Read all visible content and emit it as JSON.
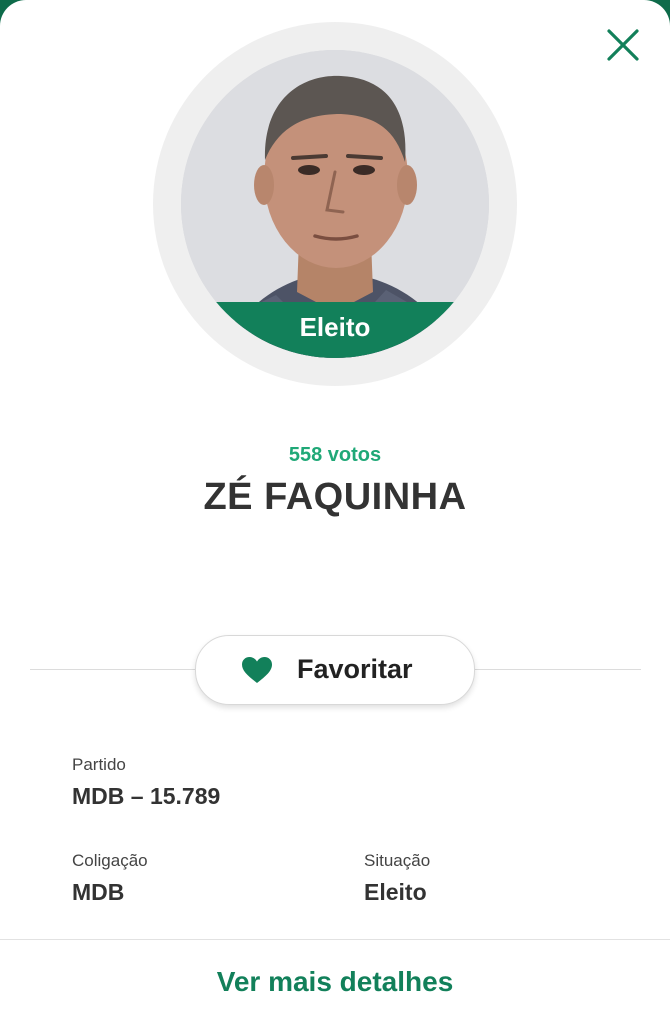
{
  "header": {
    "close_icon": "close-icon"
  },
  "candidate": {
    "status_badge": "Eleito",
    "votes": "558 votos",
    "name": "ZÉ FAQUINHA"
  },
  "favorite": {
    "icon": "heart-icon",
    "label": "Favoritar"
  },
  "info": {
    "partido_label": "Partido",
    "partido_value": "MDB – 15.789",
    "coligacao_label": "Coligação",
    "coligacao_value": "MDB",
    "situacao_label": "Situação",
    "situacao_value": "Eleito"
  },
  "footer": {
    "details_link": "Ver mais detalhes"
  },
  "colors": {
    "brand_green": "#12805a",
    "votes_green": "#1fa877",
    "text_dark": "#333333"
  }
}
